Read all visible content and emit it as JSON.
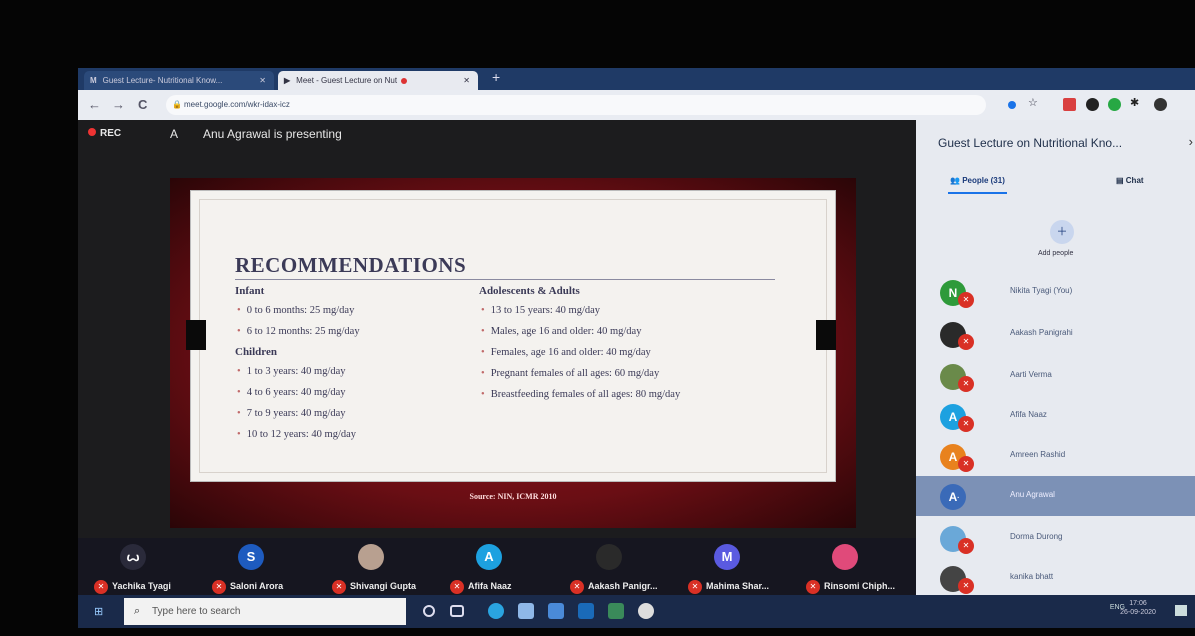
{
  "browser": {
    "tabs": [
      {
        "icon": "M",
        "label": "Guest Lecture- Nutritional Know...",
        "close": "✕"
      },
      {
        "icon": "▶",
        "label": "Meet - Guest Lecture on Nut",
        "close": "✕"
      }
    ],
    "new_tab": "+",
    "url": "meet.google.com/wkr-idax-icz",
    "nav": {
      "back": "←",
      "forward": "→",
      "reload": "C"
    }
  },
  "meet": {
    "rec_label": "REC",
    "presenter_initial": "A",
    "presenting_text": "Anu Agrawal is presenting"
  },
  "slide": {
    "title": "RECOMMENDATIONS",
    "left_sections": [
      {
        "heading": "Infant",
        "items": [
          "0 to 6 months: 25 mg/day",
          "6 to 12 months: 25 mg/day"
        ]
      },
      {
        "heading": "Children",
        "items": [
          "1 to 3 years: 40 mg/day",
          "4 to 6 years: 40 mg/day",
          "7 to 9 years: 40 mg/day",
          "10 to 12 years: 40 mg/day"
        ]
      }
    ],
    "right_heading": "Adolescents & Adults",
    "right_items": [
      "13 to 15 years: 40  mg/day",
      "Males, age 16 and older: 40 mg/day",
      "Females, age 16  and older: 40 mg/day",
      "Pregnant females of all ages: 60 mg/day",
      "Breastfeeding females of all ages: 80 mg/day"
    ],
    "source": "Source: NIN, ICMR 2010"
  },
  "participants_strip": [
    {
      "name": "Yachika Tyagi",
      "initial": "ꙍ",
      "color": "#2a2a3a"
    },
    {
      "name": "Saloni Arora",
      "initial": "S",
      "color": "#1e5bbf"
    },
    {
      "name": "Shivangi Gupta",
      "initial": "",
      "color": "#b8a090"
    },
    {
      "name": "Afifa Naaz",
      "initial": "A",
      "color": "#1da1e0"
    },
    {
      "name": "Aakash Panigr...",
      "initial": "",
      "color": "#2a2a2a"
    },
    {
      "name": "Mahima Shar...",
      "initial": "M",
      "color": "#5a5ae0"
    },
    {
      "name": "Rinsomi Chiph...",
      "initial": "",
      "color": "#e04a7a"
    }
  ],
  "panel": {
    "title": "Guest Lecture on Nutritional Kno...",
    "close": "›",
    "people_tab": "People (31)",
    "chat_tab": "Chat",
    "add_people": "Add people",
    "people": [
      {
        "name": "Nikita Tyagi (You)",
        "initial": "N",
        "color": "#2e9a3a",
        "muted": true,
        "highlight": false
      },
      {
        "name": "Aakash Panigrahi",
        "initial": "",
        "color": "#2a2a2a",
        "muted": true,
        "highlight": false
      },
      {
        "name": "Aarti Verma",
        "initial": "",
        "color": "#6a8a4a",
        "muted": true,
        "highlight": false
      },
      {
        "name": "Afifa Naaz",
        "initial": "A",
        "color": "#1da1e0",
        "muted": true,
        "highlight": false
      },
      {
        "name": "Amreen Rashid",
        "initial": "A",
        "color": "#e8821e",
        "muted": true,
        "highlight": false
      },
      {
        "name": "Anu Agrawal",
        "initial": "A",
        "color": "#3a6ab8",
        "muted": false,
        "highlight": true
      },
      {
        "name": "Dorma Durong",
        "initial": "",
        "color": "#6aa8d8",
        "muted": true,
        "highlight": false
      },
      {
        "name": "kanika bhatt",
        "initial": "",
        "color": "#444",
        "muted": true,
        "highlight": false
      }
    ]
  },
  "taskbar": {
    "search_placeholder": "Type here to search",
    "tray_text": "ENG",
    "time": "17:06",
    "date": "26-09-2020"
  }
}
